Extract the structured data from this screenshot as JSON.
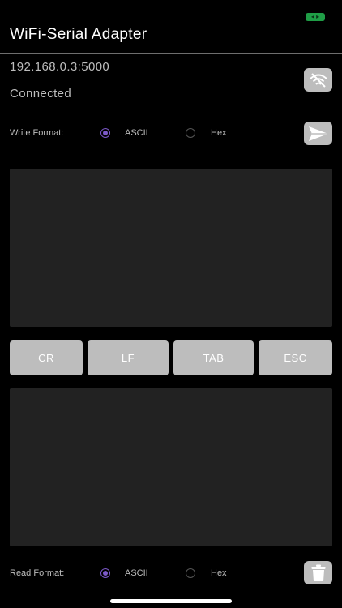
{
  "status_bar": {
    "battery_icon": "battery-icon",
    "battery_color": "#1f9d46"
  },
  "header": {
    "title": "WiFi-Serial Adapter"
  },
  "connection": {
    "address": "192.168.0.3:5000",
    "status": "Connected",
    "disconnect_icon": "wifi-off-icon",
    "send_icon": "send-icon"
  },
  "write_format": {
    "label": "Write Format:",
    "options": [
      {
        "label": "ASCII",
        "selected": true
      },
      {
        "label": "Hex",
        "selected": false
      }
    ]
  },
  "keys": [
    {
      "label": "CR"
    },
    {
      "label": "LF"
    },
    {
      "label": "TAB"
    },
    {
      "label": "ESC"
    }
  ],
  "read_format": {
    "label": "Read Format:",
    "options": [
      {
        "label": "ASCII",
        "selected": true
      },
      {
        "label": "Hex",
        "selected": false
      }
    ],
    "clear_icon": "trash-icon"
  },
  "colors": {
    "accent": "#7c59c9",
    "button": "#bdbdbd",
    "panel": "#222222",
    "background": "#000000"
  }
}
